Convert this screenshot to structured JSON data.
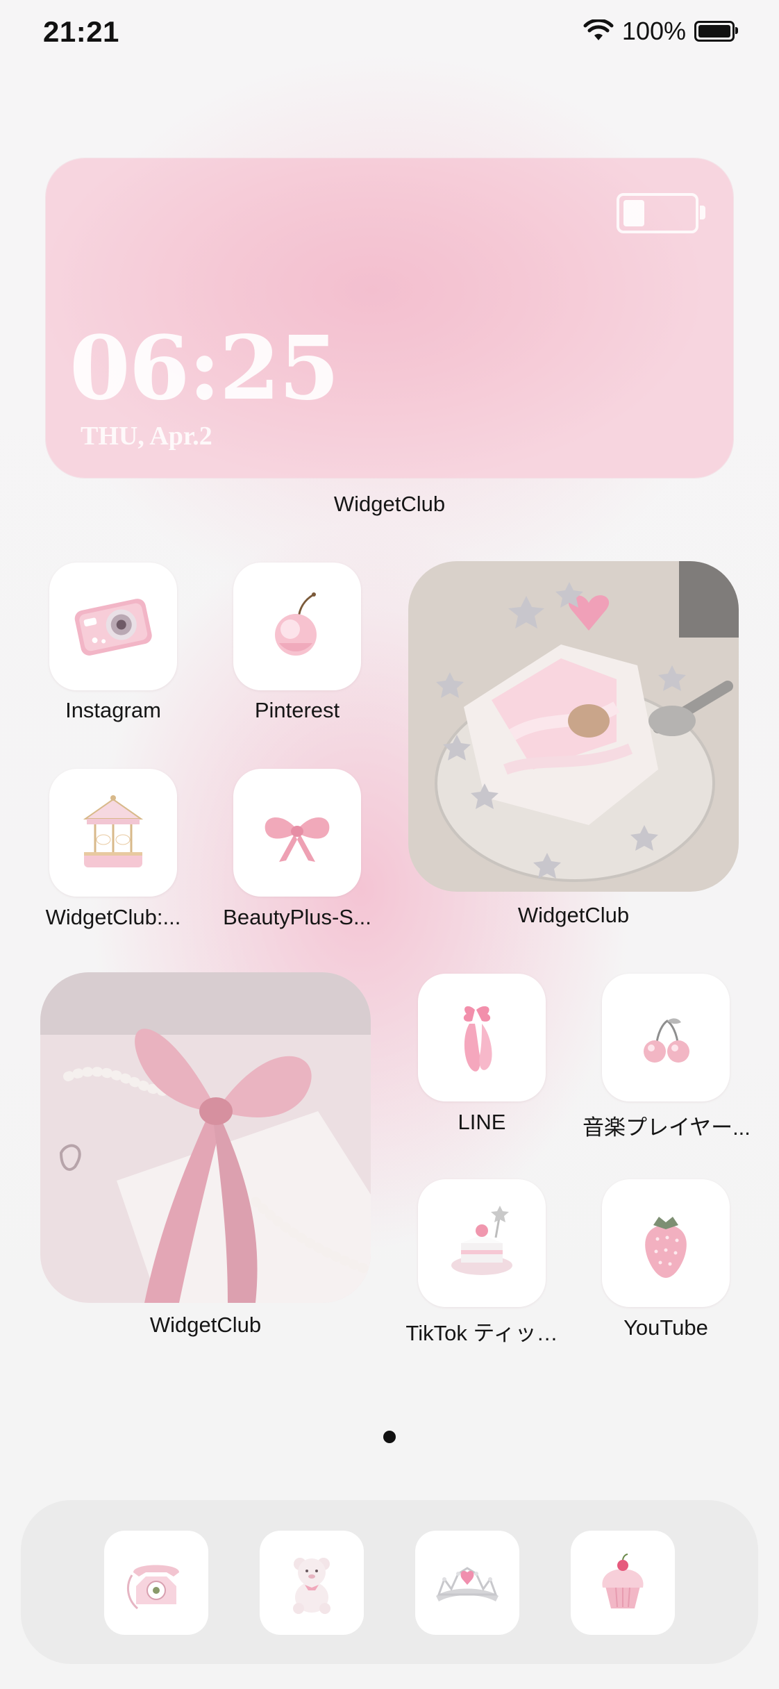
{
  "status_bar": {
    "time": "21:21",
    "battery_percent": "100%",
    "icons": [
      "wifi-icon",
      "battery-icon"
    ]
  },
  "clock_widget": {
    "time": "06:25",
    "date": "THU, Apr.2",
    "label": "WidgetClub"
  },
  "apps": [
    {
      "label": "Instagram",
      "icon": "pink-camera-icon"
    },
    {
      "label": "Pinterest",
      "icon": "cherry-icon"
    },
    {
      "label": "WidgetClub:...",
      "icon": "carousel-music-box-icon"
    },
    {
      "label": "BeautyPlus-S...",
      "icon": "pink-bow-icon"
    },
    {
      "label": "LINE",
      "icon": "ballet-shoes-icon"
    },
    {
      "label": "音楽プレイヤー...",
      "icon": "cherries-icon"
    },
    {
      "label": "TikTok ティッ…",
      "icon": "cake-slice-icon"
    },
    {
      "label": "YouTube",
      "icon": "strawberry-icon"
    }
  ],
  "photo_widgets": [
    {
      "label": "WidgetClub",
      "subject": "cake-photo"
    },
    {
      "label": "WidgetClub",
      "subject": "ribbon-pearls-photo"
    }
  ],
  "page_indicator": {
    "pages": 1,
    "current": 1
  },
  "dock": [
    {
      "icon": "rotary-phone-icon"
    },
    {
      "icon": "teddy-bear-icon"
    },
    {
      "icon": "tiara-icon"
    },
    {
      "icon": "cupcake-icon"
    }
  ],
  "colors": {
    "accent_pink": "#f3bfcf",
    "icon_bg": "#ffffff",
    "text": "#151515"
  }
}
